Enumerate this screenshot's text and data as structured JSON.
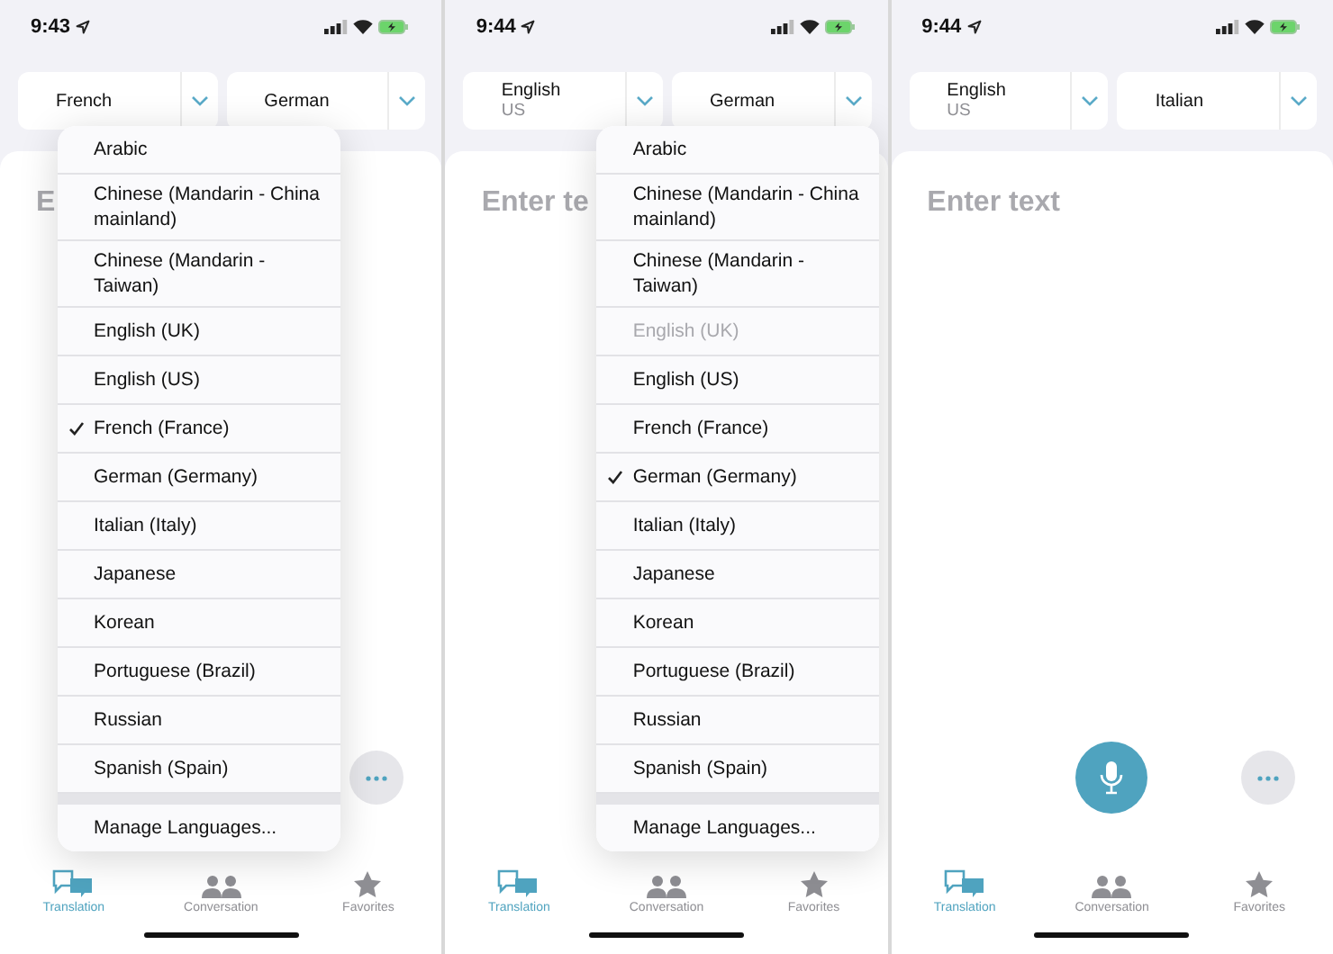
{
  "screens": [
    {
      "time": "9:43",
      "pickers": [
        {
          "language": "French",
          "menu": {
            "items": [
              {
                "label": "Arabic",
                "checked": false,
                "disabled": false
              },
              {
                "label": "Chinese (Mandarin - China mainland)",
                "checked": false,
                "disabled": false
              },
              {
                "label": "Chinese (Mandarin - Taiwan)",
                "checked": false,
                "disabled": false
              },
              {
                "label": "English (UK)",
                "checked": false,
                "disabled": false
              },
              {
                "label": "English (US)",
                "checked": false,
                "disabled": false
              },
              {
                "label": "French (France)",
                "checked": true,
                "disabled": false
              },
              {
                "label": "German (Germany)",
                "checked": false,
                "disabled": false
              },
              {
                "label": "Italian (Italy)",
                "checked": false,
                "disabled": false
              },
              {
                "label": "Japanese",
                "checked": false,
                "disabled": false
              },
              {
                "label": "Korean",
                "checked": false,
                "disabled": false
              },
              {
                "label": "Portuguese (Brazil)",
                "checked": false,
                "disabled": false
              },
              {
                "label": "Russian",
                "checked": false,
                "disabled": false
              },
              {
                "label": "Spanish (Spain)",
                "checked": false,
                "disabled": false
              }
            ],
            "footer": "Manage Languages..."
          }
        },
        {
          "language": "German"
        }
      ],
      "placeholder": "E",
      "mic_button": false,
      "more_button": true,
      "tabs": [
        {
          "label": "Translation",
          "selected": true
        },
        {
          "label": "Conversation",
          "selected": false
        },
        {
          "label": "Favorites",
          "selected": false
        }
      ]
    },
    {
      "time": "9:44",
      "pickers": [
        {
          "language": "English",
          "region": "US"
        },
        {
          "language": "German",
          "menu": {
            "items": [
              {
                "label": "Arabic",
                "checked": false,
                "disabled": false
              },
              {
                "label": "Chinese (Mandarin - China mainland)",
                "checked": false,
                "disabled": false
              },
              {
                "label": "Chinese (Mandarin - Taiwan)",
                "checked": false,
                "disabled": false
              },
              {
                "label": "English (UK)",
                "checked": false,
                "disabled": true
              },
              {
                "label": "English (US)",
                "checked": false,
                "disabled": false
              },
              {
                "label": "French (France)",
                "checked": false,
                "disabled": false
              },
              {
                "label": "German (Germany)",
                "checked": true,
                "disabled": false
              },
              {
                "label": "Italian (Italy)",
                "checked": false,
                "disabled": false
              },
              {
                "label": "Japanese",
                "checked": false,
                "disabled": false
              },
              {
                "label": "Korean",
                "checked": false,
                "disabled": false
              },
              {
                "label": "Portuguese (Brazil)",
                "checked": false,
                "disabled": false
              },
              {
                "label": "Russian",
                "checked": false,
                "disabled": false
              },
              {
                "label": "Spanish (Spain)",
                "checked": false,
                "disabled": false
              }
            ],
            "footer": "Manage Languages..."
          }
        }
      ],
      "placeholder": "Enter te",
      "mic_button": false,
      "more_button": false,
      "tabs": [
        {
          "label": "Translation",
          "selected": true
        },
        {
          "label": "Conversation",
          "selected": false
        },
        {
          "label": "Favorites",
          "selected": false
        }
      ]
    },
    {
      "time": "9:44",
      "pickers": [
        {
          "language": "English",
          "region": "US"
        },
        {
          "language": "Italian"
        }
      ],
      "placeholder": "Enter text",
      "mic_button": true,
      "more_button": true,
      "tabs": [
        {
          "label": "Translation",
          "selected": true
        },
        {
          "label": "Conversation",
          "selected": false
        },
        {
          "label": "Favorites",
          "selected": false
        }
      ]
    }
  ]
}
